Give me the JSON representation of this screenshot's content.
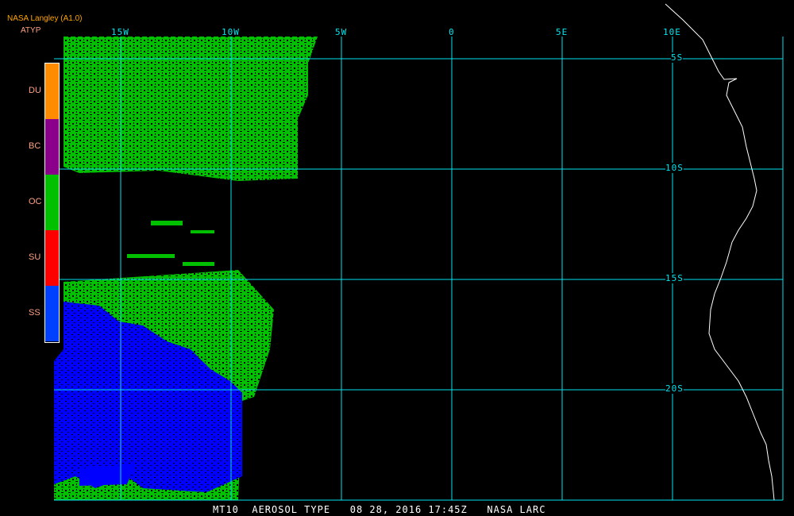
{
  "header": {
    "title": "NASA Langley (A1.0)",
    "product": "ATYP"
  },
  "legend": [
    {
      "label": "DU",
      "color": "#ff8c00"
    },
    {
      "label": "BC",
      "color": "#8b008b"
    },
    {
      "label": "OC",
      "color": "#00c000"
    },
    {
      "label": "SU",
      "color": "#ff0000"
    },
    {
      "label": "SS",
      "color": "#0040ff"
    }
  ],
  "lon_labels": [
    "15W",
    "10W",
    "5W",
    "0",
    "5E",
    "10E"
  ],
  "lat_labels": [
    "5S",
    "10S",
    "15S",
    "20S"
  ],
  "footer": "MT10  AEROSOL TYPE   08 28, 2016 17:45Z   NASA LARC",
  "colors": {
    "grid": "#00e5ee",
    "coast": "#ffffff"
  }
}
